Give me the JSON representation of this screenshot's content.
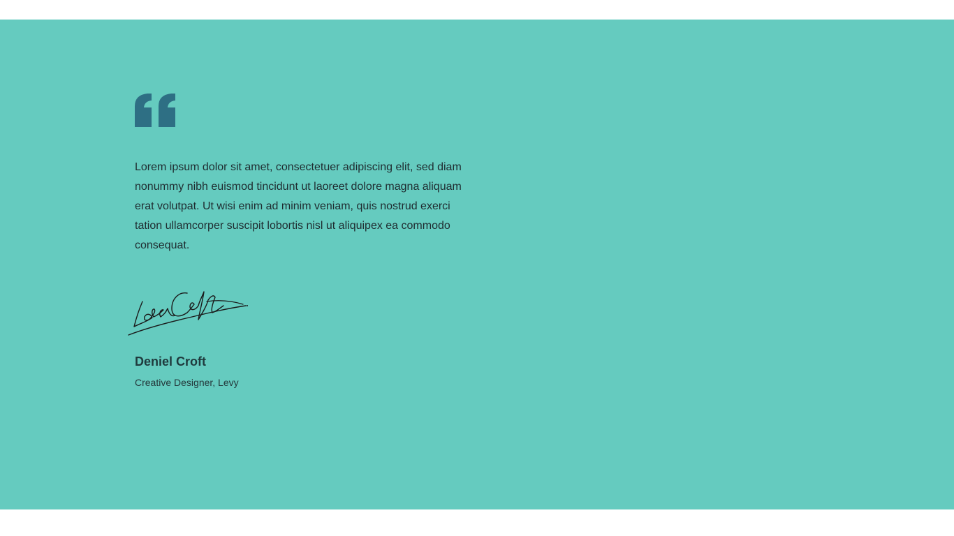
{
  "testimonial": {
    "quote": "Lorem ipsum dolor sit amet, consectetuer adipiscing elit, sed diam nonummy nibh euismod tincidunt ut laoreet dolore magna aliquam erat volutpat. Ut wisi enim ad minim veniam, quis nostrud exerci tation ullamcorper suscipit lobortis nisl ut aliquipex ea commodo consequat.",
    "quote_icon": "quote-icon",
    "signature_text": "LaraCroft",
    "author_name": "Deniel Croft",
    "author_role": "Creative Designer, Levy"
  },
  "colors": {
    "background": "#65cbbf",
    "quote_icon": "#2e6f84",
    "text": "#1f2c30"
  }
}
